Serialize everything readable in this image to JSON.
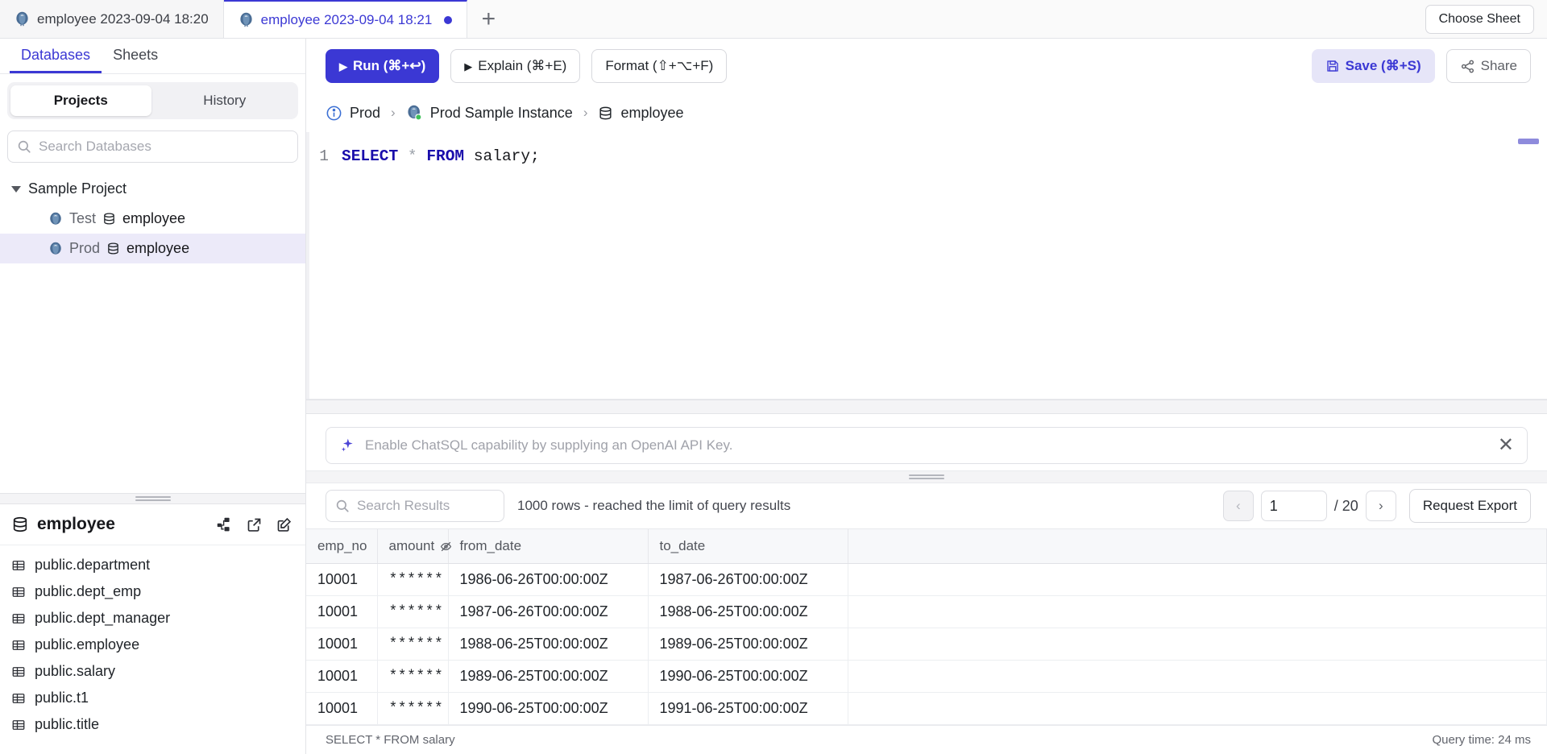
{
  "window": {
    "tabs": [
      {
        "label": "employee 2023-09-04 18:20",
        "icon": "postgres-icon",
        "active": false,
        "dirty": false
      },
      {
        "label": "employee 2023-09-04 18:21",
        "icon": "postgres-icon",
        "active": true,
        "dirty": true
      }
    ],
    "new_tab_label": "+",
    "choose_sheet_label": "Choose Sheet"
  },
  "sidebar": {
    "top_tabs": [
      {
        "label": "Databases",
        "active": true
      },
      {
        "label": "Sheets",
        "active": false
      }
    ],
    "segments": [
      {
        "label": "Projects",
        "active": true
      },
      {
        "label": "History",
        "active": false
      }
    ],
    "search": {
      "placeholder": "Search Databases",
      "value": ""
    },
    "tree": {
      "project": "Sample Project",
      "databases": [
        {
          "env": "Test",
          "name": "employee",
          "selected": false
        },
        {
          "env": "Prod",
          "name": "employee",
          "selected": true
        }
      ]
    },
    "schema": {
      "title": "employee",
      "actions": [
        "diagram-icon",
        "external-link-icon",
        "edit-icon"
      ],
      "tables": [
        "public.department",
        "public.dept_emp",
        "public.dept_manager",
        "public.employee",
        "public.salary",
        "public.t1",
        "public.title"
      ]
    }
  },
  "toolbar": {
    "run_label": "Run (⌘+↩)",
    "explain_label": "Explain (⌘+E)",
    "format_label": "Format (⇧+⌥+F)",
    "save_label": "Save (⌘+S)",
    "share_label": "Share"
  },
  "breadcrumb": [
    {
      "label": "Prod",
      "icon": "info-icon"
    },
    {
      "label": "Prod Sample Instance",
      "icon": "postgres-icon"
    },
    {
      "label": "employee",
      "icon": "database-icon"
    }
  ],
  "editor": {
    "line_number": "1",
    "tokens": [
      {
        "text": "SELECT",
        "type": "keyword"
      },
      {
        "text": " ",
        "type": "plain"
      },
      {
        "text": "*",
        "type": "star"
      },
      {
        "text": " ",
        "type": "plain"
      },
      {
        "text": "FROM",
        "type": "keyword"
      },
      {
        "text": " ",
        "type": "plain"
      },
      {
        "text": "salary;",
        "type": "ident"
      }
    ]
  },
  "chatsql": {
    "message": "Enable ChatSQL capability by supplying an OpenAI API Key.",
    "icon": "sparkle-icon",
    "close_label": "✕"
  },
  "results": {
    "search": {
      "placeholder": "Search Results",
      "value": ""
    },
    "status": "1000 rows  -  reached the limit of query results",
    "pagination": {
      "prev_label": "‹",
      "next_label": "›",
      "current_page": "1",
      "total_pages": "/ 20"
    },
    "export_label": "Request Export",
    "columns": [
      {
        "name": "emp_no",
        "masked": false
      },
      {
        "name": "amount",
        "masked": true
      },
      {
        "name": "from_date",
        "masked": false
      },
      {
        "name": "to_date",
        "masked": false
      }
    ],
    "rows": [
      {
        "emp_no": "10001",
        "amount": "******",
        "from_date": "1986-06-26T00:00:00Z",
        "to_date": "1987-06-26T00:00:00Z"
      },
      {
        "emp_no": "10001",
        "amount": "******",
        "from_date": "1987-06-26T00:00:00Z",
        "to_date": "1988-06-25T00:00:00Z"
      },
      {
        "emp_no": "10001",
        "amount": "******",
        "from_date": "1988-06-25T00:00:00Z",
        "to_date": "1989-06-25T00:00:00Z"
      },
      {
        "emp_no": "10001",
        "amount": "******",
        "from_date": "1989-06-25T00:00:00Z",
        "to_date": "1990-06-25T00:00:00Z"
      },
      {
        "emp_no": "10001",
        "amount": "******",
        "from_date": "1990-06-25T00:00:00Z",
        "to_date": "1991-06-25T00:00:00Z"
      }
    ]
  },
  "statusbar": {
    "query": "SELECT * FROM salary",
    "query_time": "Query time: 24 ms"
  },
  "colors": {
    "accent": "#3b38d4",
    "accent_soft": "#e6e5f8",
    "selected_row": "#eceaf9",
    "border": "#e3e4e8",
    "muted_text": "#a5a7af"
  }
}
